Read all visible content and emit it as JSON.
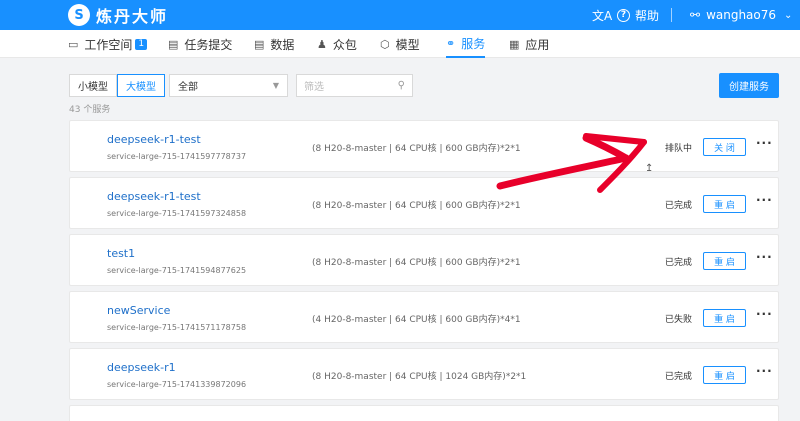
{
  "header": {
    "logo_mark": "S",
    "app_name": "炼丹大师",
    "lang_icon": "文A",
    "help_label": "帮助",
    "username": "wanghao76"
  },
  "nav": {
    "items": [
      {
        "label": "工作空间",
        "badge": "1",
        "icon": "monitor-icon"
      },
      {
        "label": "任务提交",
        "icon": "list-icon"
      },
      {
        "label": "数据",
        "icon": "book-icon"
      },
      {
        "label": "众包",
        "icon": "people-icon"
      },
      {
        "label": "模型",
        "icon": "cube-icon"
      },
      {
        "label": "服务",
        "icon": "link-icon",
        "active": true
      },
      {
        "label": "应用",
        "icon": "grid-icon"
      }
    ]
  },
  "filters": {
    "small_model": "小模型",
    "large_model": "大模型",
    "select_value": "全部",
    "search_placeholder": "筛选",
    "create_button": "创建服务",
    "count_text": "43 个服务"
  },
  "services": [
    {
      "name": "deepseek-r1-test",
      "id": "service-large-715-1741597778737",
      "spec": "(8 H20-8-master | 64 CPU核 | 600 GB内存)*2*1",
      "status": "排队中",
      "action": "关 闭"
    },
    {
      "name": "deepseek-r1-test",
      "id": "service-large-715-1741597324858",
      "spec": "(8 H20-8-master | 64 CPU核 | 600 GB内存)*2*1",
      "status": "已完成",
      "action": "重 启"
    },
    {
      "name": "test1",
      "id": "service-large-715-1741594877625",
      "spec": "(8 H20-8-master | 64 CPU核 | 600 GB内存)*2*1",
      "status": "已完成",
      "action": "重 启"
    },
    {
      "name": "newService",
      "id": "service-large-715-1741571178758",
      "spec": "(4 H20-8-master | 64 CPU核 | 600 GB内存)*4*1",
      "status": "已失败",
      "action": "重 启"
    },
    {
      "name": "deepseek-r1",
      "id": "service-large-715-1741339872096",
      "spec": "(8 H20-8-master | 64 CPU核 | 1024 GB内存)*2*1",
      "status": "已完成",
      "action": "重 启"
    }
  ],
  "colors": {
    "primary": "#1890ff",
    "annotation_arrow": "#e8002a"
  }
}
